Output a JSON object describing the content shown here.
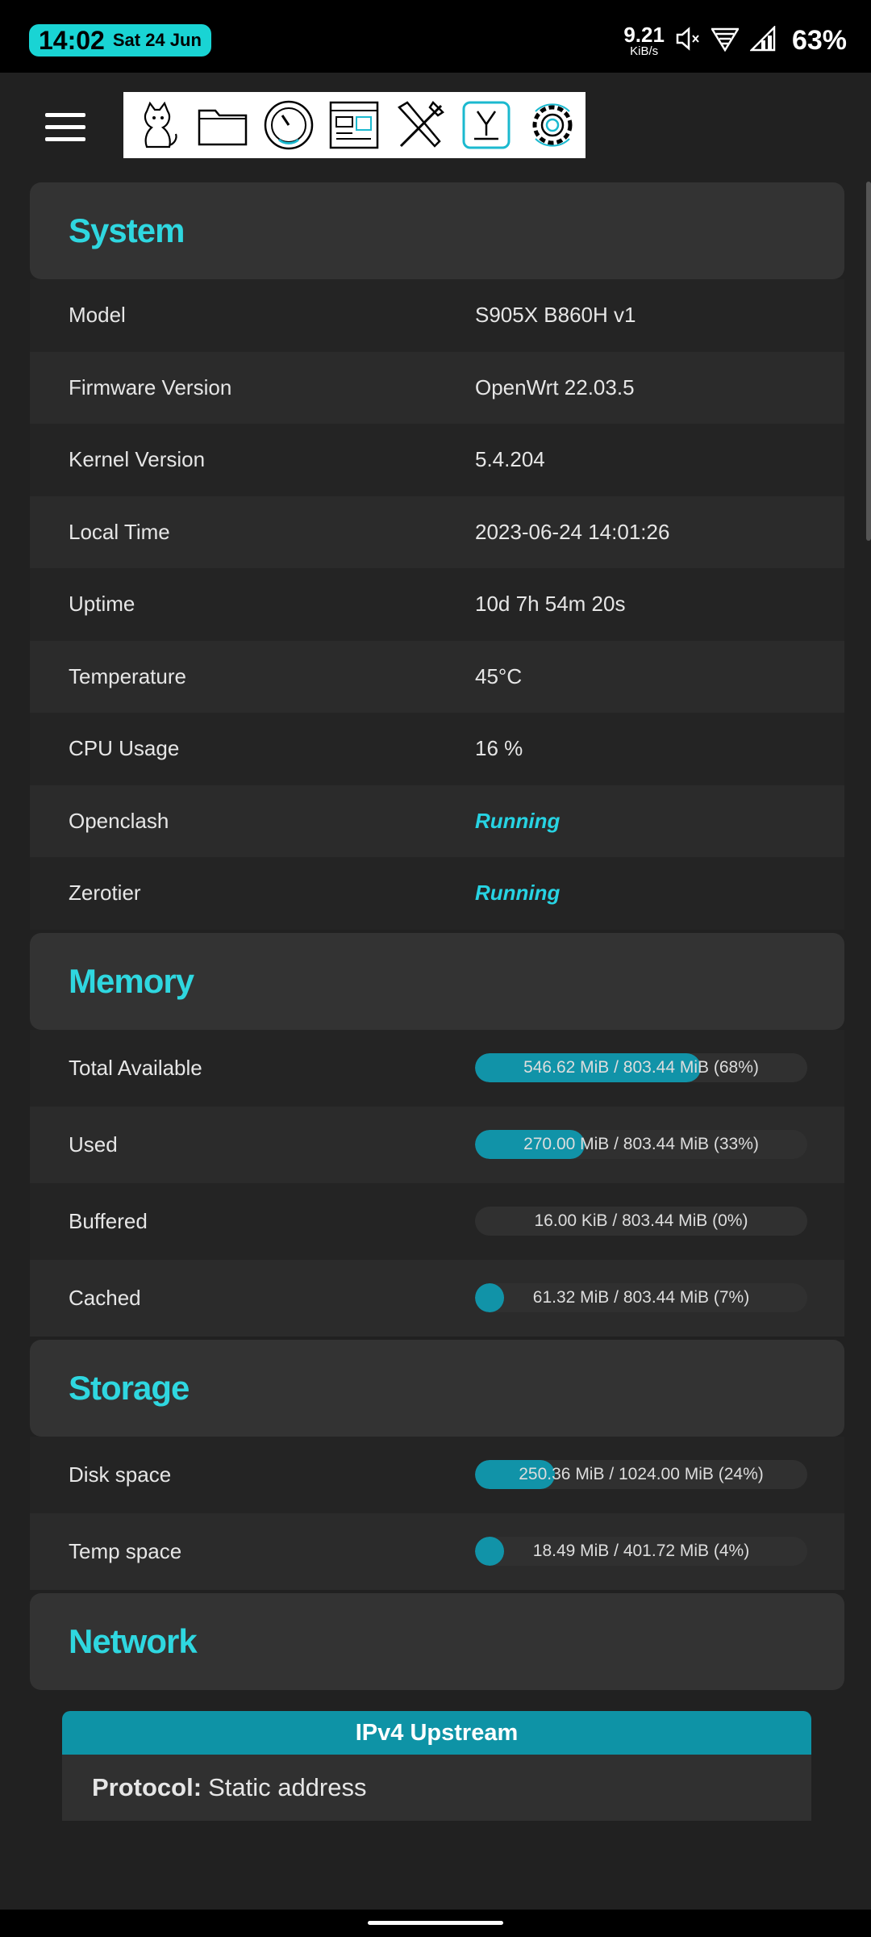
{
  "status_bar": {
    "time": "14:02",
    "date": "Sat 24 Jun",
    "net_speed": "9.21",
    "net_speed_unit": "KiB/s",
    "battery": "63%",
    "icons": [
      "mute-icon",
      "wifi-icon",
      "cell-signal-icon"
    ]
  },
  "toolbar": {
    "icons": [
      "cat-icon",
      "folder-icon",
      "gauge-icon",
      "dashboard-icon",
      "tools-icon",
      "y-app-icon",
      "settings-icon"
    ]
  },
  "colors": {
    "accent": "#2fd7e0",
    "bar_fill": "#1193a8",
    "clock_bg": "#19d4d4"
  },
  "system": {
    "title": "System",
    "rows": [
      {
        "label": "Model",
        "value": "S905X B860H v1"
      },
      {
        "label": "Firmware Version",
        "value": "OpenWrt 22.03.5"
      },
      {
        "label": "Kernel Version",
        "value": "5.4.204"
      },
      {
        "label": "Local Time",
        "value": "2023-06-24 14:01:26"
      },
      {
        "label": "Uptime",
        "value": "10d 7h 54m 20s"
      },
      {
        "label": "Temperature",
        "value": "45°C"
      },
      {
        "label": "CPU Usage",
        "value": "16 %"
      },
      {
        "label": "Openclash",
        "value": "Running"
      },
      {
        "label": "Zerotier",
        "value": "Running"
      }
    ]
  },
  "memory": {
    "title": "Memory",
    "rows": [
      {
        "label": "Total Available",
        "text": "546.62 MiB / 803.44 MiB (68%)",
        "percent": 68
      },
      {
        "label": "Used",
        "text": "270.00 MiB / 803.44 MiB (33%)",
        "percent": 33
      },
      {
        "label": "Buffered",
        "text": "16.00 KiB / 803.44 MiB (0%)",
        "percent": 0
      },
      {
        "label": "Cached",
        "text": "61.32 MiB / 803.44 MiB (7%)",
        "percent": 7
      }
    ]
  },
  "storage": {
    "title": "Storage",
    "rows": [
      {
        "label": "Disk space",
        "text": "250.36 MiB / 1024.00 MiB (24%)",
        "percent": 24
      },
      {
        "label": "Temp space",
        "text": "18.49 MiB / 401.72 MiB (4%)",
        "percent": 4
      }
    ]
  },
  "network": {
    "title": "Network",
    "card_title": "IPv4 Upstream",
    "protocol_label": "Protocol:",
    "protocol_value": "Static address"
  }
}
